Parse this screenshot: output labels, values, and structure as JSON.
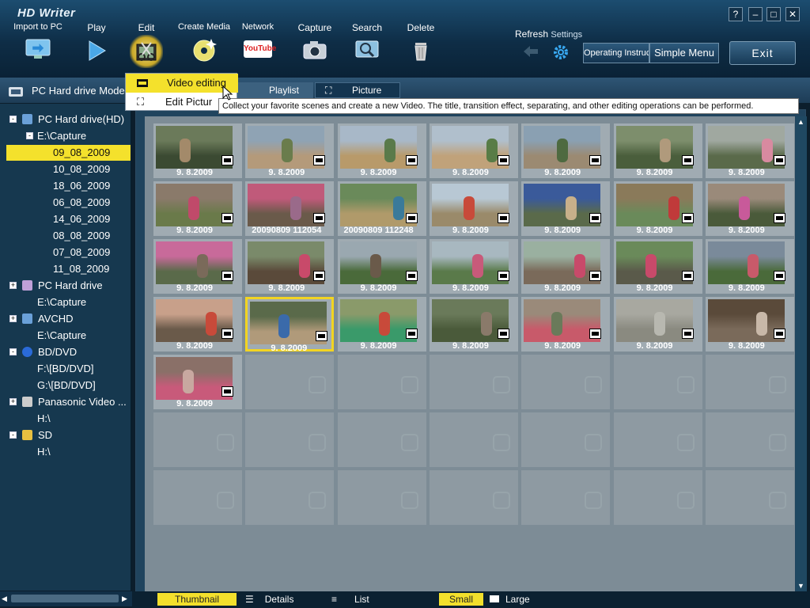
{
  "app": {
    "title": "HD Writer"
  },
  "toolbar": {
    "import": "Import to PC",
    "play": "Play",
    "edit": "Edit",
    "create_media": "Create Media",
    "network": "Network",
    "network_logo": "YouTube",
    "capture": "Capture",
    "search": "Search",
    "delete": "Delete",
    "refresh": "Refresh",
    "settings": "Settings",
    "operating_instructions": "Operating Instructions",
    "simple_menu": "Simple Menu",
    "exit": "Exit",
    "window_help": "?"
  },
  "mode": {
    "label": "PC Hard drive Mode"
  },
  "tabs": {
    "playlist": "Playlist",
    "picture": "Picture"
  },
  "edit_menu": {
    "video_editing": "Video editing",
    "edit_picture": "Edit Pictur"
  },
  "tooltip": "Collect your favorite scenes and create a new Video.  The title, transition effect, separating, and other editing operations can be performed.",
  "tree": [
    {
      "label": "PC Hard drive(HD)",
      "icon": "hdd-icon"
    },
    {
      "label": "E:\\Capture",
      "icon": ""
    },
    {
      "label": "09_08_2009",
      "icon": "",
      "selected": true
    },
    {
      "label": "10_08_2009",
      "icon": ""
    },
    {
      "label": "18_06_2009",
      "icon": ""
    },
    {
      "label": "06_08_2009",
      "icon": ""
    },
    {
      "label": "14_06_2009",
      "icon": ""
    },
    {
      "label": "08_08_2009",
      "icon": ""
    },
    {
      "label": "07_08_2009",
      "icon": ""
    },
    {
      "label": "11_08_2009",
      "icon": ""
    },
    {
      "label": "PC Hard drive",
      "icon": "hdd-sd-icon"
    },
    {
      "label": "E:\\Capture",
      "icon": ""
    },
    {
      "label": "AVCHD",
      "icon": "avchd-icon"
    },
    {
      "label": "E:\\Capture",
      "icon": ""
    },
    {
      "label": "BD/DVD",
      "icon": "disc-icon"
    },
    {
      "label": "F:\\[BD/DVD]",
      "icon": ""
    },
    {
      "label": "G:\\[BD/DVD]",
      "icon": ""
    },
    {
      "label": "Panasonic Video ...",
      "icon": "camera-icon"
    },
    {
      "label": "H:\\",
      "icon": ""
    },
    {
      "label": "SD",
      "icon": "sd-card-icon"
    },
    {
      "label": "H:\\",
      "icon": ""
    }
  ],
  "thumbnails": [
    {
      "caption": "9. 8.2009",
      "colors": [
        "#6b7a5a",
        "#a38a6a",
        "#3b4a32"
      ]
    },
    {
      "caption": "9. 8.2009",
      "colors": [
        "#8fa3b4",
        "#6a7c4c",
        "#b49a7a"
      ]
    },
    {
      "caption": "9. 8.2009",
      "colors": [
        "#a8b8c8",
        "#5a7a4a",
        "#b89a6a"
      ]
    },
    {
      "caption": "9. 8.2009",
      "colors": [
        "#b0bfcc",
        "#587c46",
        "#c0a27a"
      ]
    },
    {
      "caption": "9. 8.2009",
      "colors": [
        "#8aa0b2",
        "#4e6a40",
        "#9b8a72"
      ]
    },
    {
      "caption": "9. 8.2009",
      "colors": [
        "#7d8e6c",
        "#b09a7c",
        "#4a5e3c"
      ]
    },
    {
      "caption": "9. 8.2009",
      "colors": [
        "#a0a8a0",
        "#d88aa0",
        "#5a6a4a"
      ]
    },
    {
      "caption": "9. 8.2009",
      "colors": [
        "#8a7a6a",
        "#c04a6a",
        "#6a7a4a"
      ]
    },
    {
      "caption": "20090809  112054",
      "colors": [
        "#c05a7a",
        "#9a6a8a",
        "#6a5a4a"
      ]
    },
    {
      "caption": "20090809  112248",
      "colors": [
        "#6a8a5a",
        "#3a7a9a",
        "#b09a6a"
      ]
    },
    {
      "caption": "9. 8.2009",
      "colors": [
        "#b8c8d4",
        "#c84a3a",
        "#9a8a6a"
      ]
    },
    {
      "caption": "9. 8.2009",
      "colors": [
        "#3a5a9a",
        "#c8b08a",
        "#5a6a4a"
      ]
    },
    {
      "caption": "9. 8.2009",
      "colors": [
        "#8a7a5a",
        "#c03a3a",
        "#6a8a5a"
      ]
    },
    {
      "caption": "9. 8.2009",
      "colors": [
        "#9a8a7a",
        "#c85a9a",
        "#4a5a3a"
      ]
    },
    {
      "caption": "9. 8.2009",
      "colors": [
        "#c86a9a",
        "#7a6a5a",
        "#5a6a4a"
      ]
    },
    {
      "caption": "9. 8.2009",
      "colors": [
        "#7a8a6a",
        "#c84a6a",
        "#5a4a3a"
      ]
    },
    {
      "caption": "9. 8.2009",
      "colors": [
        "#9aa8b0",
        "#6a5a4a",
        "#4a6a3a"
      ]
    },
    {
      "caption": "9. 8.2009",
      "colors": [
        "#a8b8c0",
        "#c85a7a",
        "#5a7a4a"
      ]
    },
    {
      "caption": "9. 8.2009",
      "colors": [
        "#9ab0a0",
        "#c84a6a",
        "#7a6a5a"
      ]
    },
    {
      "caption": "9. 8.2009",
      "colors": [
        "#6a8a5a",
        "#c84a6a",
        "#5a5a4a"
      ]
    },
    {
      "caption": "9. 8.2009",
      "colors": [
        "#7a8a9a",
        "#c85a6a",
        "#4a6a3a"
      ]
    },
    {
      "caption": "9. 8.2009",
      "colors": [
        "#c8a08a",
        "#c84a3a",
        "#6a5a4a"
      ]
    },
    {
      "caption": "9. 8.2009",
      "colors": [
        "#5a6a4a",
        "#3a6aaa",
        "#b09a7a"
      ],
      "selected": true
    },
    {
      "caption": "9. 8.2009",
      "colors": [
        "#8a9a6a",
        "#c84a3a",
        "#3a9a6a"
      ]
    },
    {
      "caption": "9. 8.2009",
      "colors": [
        "#6a7a5a",
        "#8a7a6a",
        "#4a5a3a"
      ]
    },
    {
      "caption": "9. 8.2009",
      "colors": [
        "#9a8a7a",
        "#6a7a5a",
        "#c85a6a"
      ]
    },
    {
      "caption": "9. 8.2009",
      "colors": [
        "#a8a8a0",
        "#b8b8b0",
        "#8a8a80"
      ]
    },
    {
      "caption": "9. 8.2009",
      "colors": [
        "#5a4a3a",
        "#c8b8a8",
        "#7a6a5a"
      ]
    },
    {
      "caption": "9. 8.2009",
      "colors": [
        "#8a7068",
        "#c8a8a0",
        "#c85a7a"
      ]
    }
  ],
  "empty_slots": 20,
  "view": {
    "thumbnail": "Thumbnail",
    "details": "Details",
    "list": "List",
    "small": "Small",
    "large": "Large"
  }
}
